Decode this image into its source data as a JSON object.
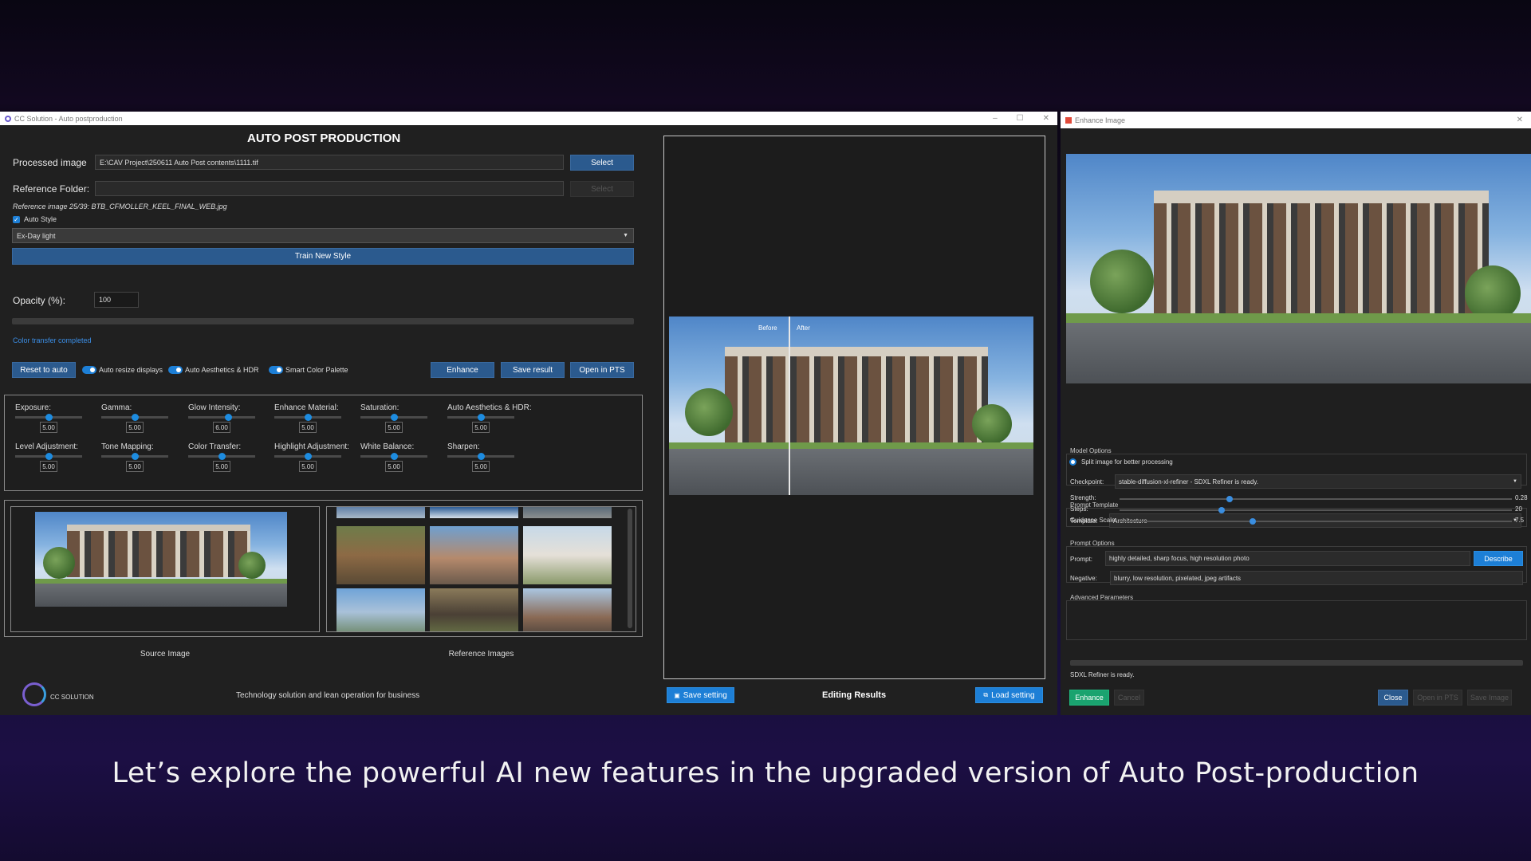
{
  "main_window": {
    "title": "CC Solution - Auto postproduction",
    "heading": "AUTO POST PRODUCTION",
    "processed_image_label": "Processed image",
    "processed_image_value": "E:\\CAV Project\\250611 Auto Post contents\\1111.tif",
    "select_label": "Select",
    "reference_folder_label": "Reference Folder:",
    "reference_folder_value": "",
    "select_disabled_label": "Select",
    "reference_image_info": "Reference image 25/39: BTB_CFMOLLER_KEEL_FINAL_WEB.jpg",
    "auto_style_label": "Auto Style",
    "style_selected": "Ex-Day light",
    "train_label": "Train New Style",
    "opacity_label": "Opacity (%):",
    "opacity_value": "100",
    "status": "Color transfer completed",
    "reset_label": "Reset to auto",
    "toggle1": "Auto resize displays",
    "toggle2": "Auto Aesthetics & HDR",
    "toggle3": "Smart Color Palette",
    "enhance_label": "Enhance",
    "save_result_label": "Save result",
    "open_pts_label": "Open in PTS",
    "sliders_row1": [
      {
        "label": "Exposure:",
        "value": "5.00",
        "level": 0.5
      },
      {
        "label": "Gamma:",
        "value": "5.00",
        "level": 0.5
      },
      {
        "label": "Glow Intensity:",
        "value": "6.00",
        "level": 0.6
      },
      {
        "label": "Enhance Material:",
        "value": "5.00",
        "level": 0.5
      },
      {
        "label": "Saturation:",
        "value": "5.00",
        "level": 0.5
      },
      {
        "label": "Auto Aesthetics & HDR:",
        "value": "5.00",
        "level": 0.5
      }
    ],
    "sliders_row2": [
      {
        "label": "Level Adjustment:",
        "value": "5.00",
        "level": 0.5
      },
      {
        "label": "Tone Mapping:",
        "value": "5.00",
        "level": 0.5
      },
      {
        "label": "Color Transfer:",
        "value": "5.00",
        "level": 0.5
      },
      {
        "label": "Highlight Adjustment:",
        "value": "5.00",
        "level": 0.5
      },
      {
        "label": "White Balance:",
        "value": "5.00",
        "level": 0.5
      },
      {
        "label": "Sharpen:",
        "value": "5.00",
        "level": 0.5
      }
    ],
    "source_caption": "Source Image",
    "reference_caption": "Reference Images",
    "logo_text": "CC SOLUTION",
    "tagline": "Technology solution and lean operation for business",
    "preview_before": "Before",
    "preview_after": "After",
    "save_setting_label": "Save setting",
    "editing_results": "Editing Results",
    "load_setting_label": "Load setting"
  },
  "enhance_window": {
    "title": "Enhance Image",
    "model_options": "Model Options",
    "split_label": "Split image for better processing",
    "checkpoint_label": "Checkpoint:",
    "checkpoint_value": "stable-diffusion-xl-refiner - SDXL Refiner is ready.",
    "prompt_template": "Prompt Template",
    "template_label": "Template:",
    "template_value": "Architecture",
    "prompt_options": "Prompt Options",
    "prompt_label": "Prompt:",
    "prompt_value": "highly detailed, sharp focus, high resolution photo",
    "describe_label": "Describe",
    "negative_label": "Negative:",
    "negative_value": "blurry, low resolution, pixelated, jpeg artifacts",
    "advanced": "Advanced Parameters",
    "params": [
      {
        "label": "Strength:",
        "value": "0.28",
        "level": 0.28
      },
      {
        "label": "Steps:",
        "value": "20",
        "level": 0.26
      },
      {
        "label": "Guidance Scale:",
        "value": "7.5",
        "level": 0.34
      }
    ],
    "status": "SDXL Refiner is ready.",
    "enhance_label": "Enhance",
    "cancel_label": "Cancel",
    "close_label": "Close",
    "open_pts_label": "Open in PTS",
    "save_image_label": "Save Image"
  },
  "caption": "Let’s explore the powerful AI new features in the upgraded version of Auto Post-production",
  "colors": {
    "accent": "#1d7fd6",
    "button": "#2b5a8e",
    "enhance_green": "#1aa36f"
  }
}
